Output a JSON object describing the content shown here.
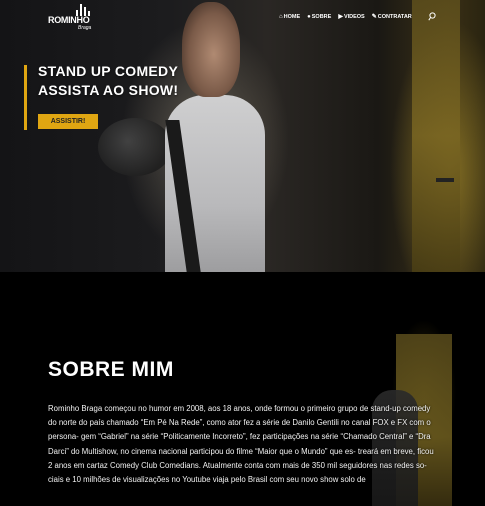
{
  "header": {
    "logo": {
      "name": "ROMINHO",
      "sub": "Braga"
    },
    "nav": [
      {
        "icon": "home-icon",
        "glyph": "⌂",
        "label": "HOME"
      },
      {
        "icon": "user-icon",
        "glyph": "●",
        "label": "SOBRE"
      },
      {
        "icon": "video-icon",
        "glyph": "▶",
        "label": "VIDEOS"
      },
      {
        "icon": "megaphone-icon",
        "glyph": "✎",
        "label": "CONTRATAR"
      }
    ]
  },
  "hero": {
    "title_line1": "STAND UP COMEDY",
    "title_line2": "ASSISTA AO SHOW!",
    "button_label": "ASSISTIR!"
  },
  "sobre": {
    "title": "SOBRE MIM",
    "text": "Rominho Braga começou no humor em 2008, aos 18 anos, onde formou o primeiro grupo de stand-up comedy do norte do país chamado “Em Pé Na Rede”, como ator fez a série de Danilo Gentili no canal FOX e FX com o persona- gem “Gabriel” na série “Politicamente Incorreto”, fez participações na série “Chamado Central” e “Dra Darci” do Multishow, no cinema nacional participou do filme “Maior que o Mundo” que es- treará em breve, ficou 2 anos em cartaz Comedy Club Comedians. Atualmente conta com mais de 350 mil seguidores nas redes so- ciais e 10 milhões de visualizações no Youtube viaja pelo Brasil com seu novo show solo de"
  },
  "colors": {
    "accent": "#e0a612"
  }
}
